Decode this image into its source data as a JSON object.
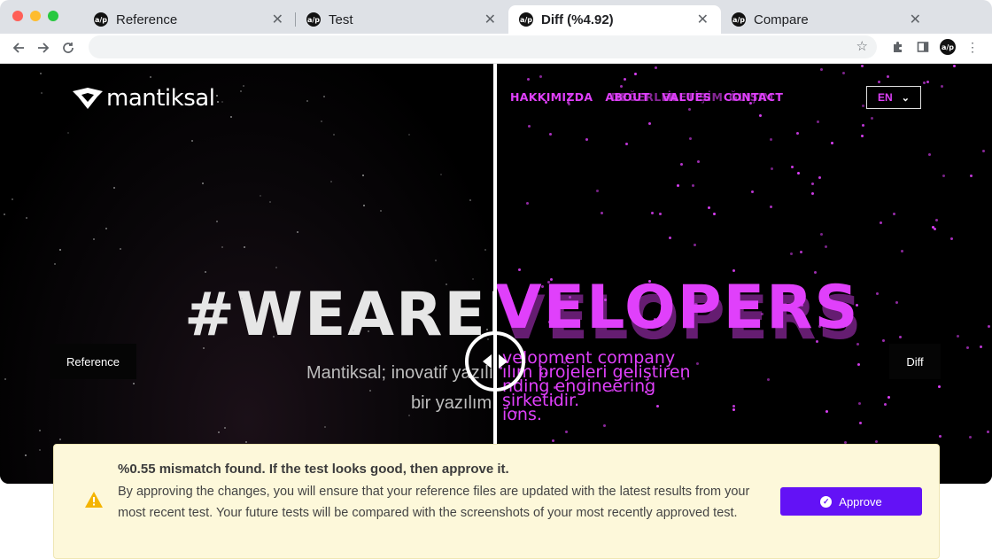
{
  "tabs": [
    {
      "title": "Reference",
      "active": false
    },
    {
      "title": "Test",
      "active": false
    },
    {
      "title": "Diff (%4.92)",
      "active": true
    },
    {
      "title": "Compare",
      "active": false
    }
  ],
  "tab_favicon": "a/p",
  "toolbar": {
    "back_icon": "arrow-left-icon",
    "forward_icon": "arrow-right-icon",
    "reload_icon": "reload-icon",
    "address_value": "",
    "bookmark_icon": "star-icon",
    "extensions_icon": "puzzle-icon",
    "sidepanel_icon": "sidepanel-icon",
    "profile_label": "a/p",
    "menu_icon": "kebab-menu-icon"
  },
  "site": {
    "brand": "mantiksal",
    "nav": [
      "HAKKIMIZDA",
      "ABOUT",
      "VALUES",
      "CONTACT"
    ],
    "nav_ghost": [
      "",
      "DEĞERLER",
      "İLETİŞİM",
      "ĞLIŞIM"
    ],
    "lang": "EN",
    "hero_left": "#WEAREDE",
    "hero_right": "VELOPERS",
    "sub_left_1": "Mantiksal; inovatif yazılım",
    "sub_left_2": "bir yazılım",
    "sub_right": [
      "velopment company",
      "ılım projeleri geliştiren",
      "nding engineering",
      "şirketidir.",
      "ions."
    ]
  },
  "compare": {
    "left_label": "Reference",
    "right_label": "Diff",
    "handle_icon": "drag-handle-icon"
  },
  "alert": {
    "title": "%0.55 mismatch found. If the test looks good, then approve it.",
    "body": "By approving the changes, you will ensure that your reference files are updated with the latest results from your most recent test. Your future tests will be compared with the screenshots of your most recently approved test.",
    "approve_label": "Approve",
    "warning_icon": "warning-icon"
  },
  "colors": {
    "diff_magenta": "#e040fb",
    "approve_purple": "#6312f6",
    "alert_bg": "#fdf8da"
  }
}
